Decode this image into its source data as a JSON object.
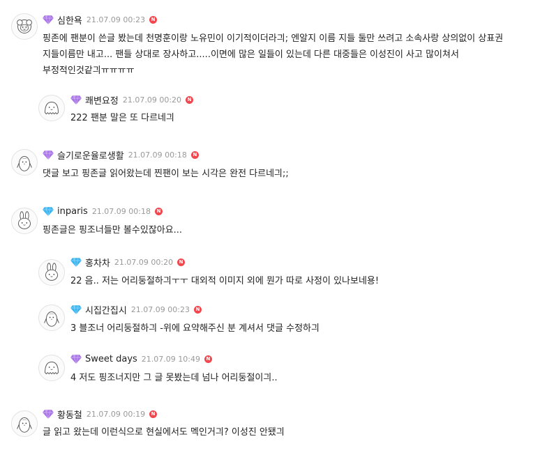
{
  "colors": {
    "purple_gem": "#a974e8",
    "blue_gem": "#39b4f2",
    "new_badge": "#f0484e",
    "date_text": "#999999"
  },
  "new_badge_label": "N",
  "comments": [
    {
      "nick": "심한욕",
      "date": "21.07.09 00:23",
      "gem": "purple-gem-icon",
      "avatar": "sheep-avatar-icon",
      "text": "핑존에 팬분이 쓴글 봤는데 천명훈이랑 노유민이 이기적이더라긔; 엔알지 이름 지들 둘만 쓰려고 소속사랑 상의없이 상표권 지들이름만 내고... 팬들 상대로 장사하고.....이면에 많은 일들이 있는데 다른 대중들은 이성진이 사고 많이쳐서 부정적인것같긔ㅠㅠㅠㅠ"
    },
    {
      "nick": "쾌변요정",
      "date": "21.07.09 00:20",
      "gem": "purple-gem-icon",
      "avatar": "ghost-avatar-icon",
      "text": "222 팬분 말은 또 다르네긔"
    },
    {
      "nick": "슬기로운율로생활",
      "date": "21.07.09 00:18",
      "gem": "purple-gem-icon",
      "avatar": "penguin-avatar-icon",
      "text": "댓글 보고 핑존글 읽어왔는데 찐팬이 보는 시각은 완전 다르네긔;;"
    },
    {
      "nick": "inparis",
      "date": "21.07.09 00:18",
      "gem": "blue-gem-icon",
      "avatar": "bunny-avatar-icon",
      "text": "핑존글은 핑조너들만 볼수있잖아요..."
    },
    {
      "nick": "홍차차",
      "date": "21.07.09 00:20",
      "gem": "blue-gem-icon",
      "avatar": "bunny-avatar-icon",
      "text": "22 음.. 저는 어리둥절하긔ㅜㅜ 대외적 이미지 외에 뭔가 따로 사정이 있나보네용!"
    },
    {
      "nick": "시집간집시",
      "date": "21.07.09 00:23",
      "gem": "blue-gem-icon",
      "avatar": "penguin-avatar-icon",
      "text": "3 블조너 어리둥절하긔 -위에 요약해주신 분 계셔서 댓글 수정하긔"
    },
    {
      "nick": "Sweet days",
      "date": "21.07.09 10:49",
      "gem": "purple-gem-icon",
      "avatar": "ghost-avatar-icon",
      "text": "4 저도 핑조너지만 그 글 못봤는데 넘나 어리둥절이긔.."
    },
    {
      "nick": "황동철",
      "date": "21.07.09 00:19",
      "gem": "purple-gem-icon",
      "avatar": "penguin-avatar-icon",
      "text": "글 읽고 왔는데 이런식으로 현실에서도 멕인거긔? 이성진 안됐긔"
    }
  ]
}
